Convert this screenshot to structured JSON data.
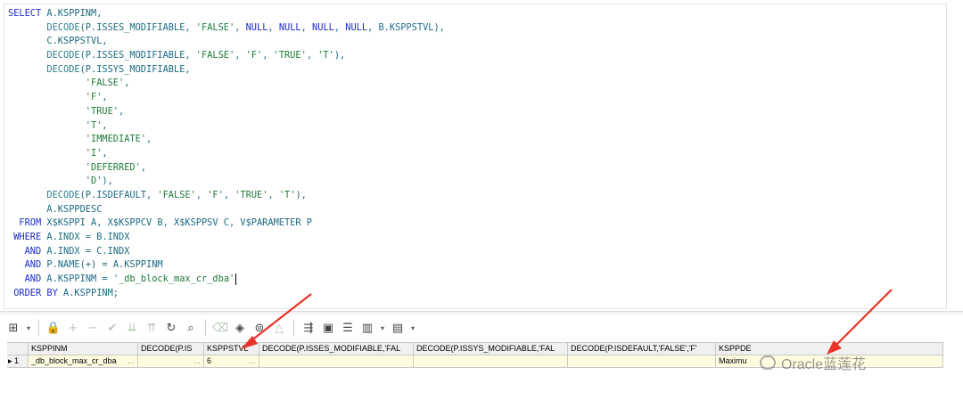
{
  "editor": {
    "lines": [
      [
        {
          "t": "SELECT ",
          "c": "kw"
        },
        {
          "t": "A.KSPPINM,",
          "c": ""
        }
      ],
      [
        {
          "t": "       ",
          "c": ""
        },
        {
          "t": "DECODE",
          "c": "fn"
        },
        {
          "t": "(P.ISSES_MODIFIABLE, ",
          "c": ""
        },
        {
          "t": "'FALSE'",
          "c": "str"
        },
        {
          "t": ", ",
          "c": ""
        },
        {
          "t": "NULL",
          "c": "nul"
        },
        {
          "t": ", ",
          "c": ""
        },
        {
          "t": "NULL",
          "c": "nul"
        },
        {
          "t": ", ",
          "c": ""
        },
        {
          "t": "NULL",
          "c": "nul"
        },
        {
          "t": ", ",
          "c": ""
        },
        {
          "t": "NULL",
          "c": "nul"
        },
        {
          "t": ", B.KSPPSTVL),",
          "c": ""
        }
      ],
      [
        {
          "t": "       C.KSPPSTVL,",
          "c": ""
        }
      ],
      [
        {
          "t": "       ",
          "c": ""
        },
        {
          "t": "DECODE",
          "c": "fn"
        },
        {
          "t": "(P.ISSES_MODIFIABLE, ",
          "c": ""
        },
        {
          "t": "'FALSE'",
          "c": "str"
        },
        {
          "t": ", ",
          "c": ""
        },
        {
          "t": "'F'",
          "c": "str"
        },
        {
          "t": ", ",
          "c": ""
        },
        {
          "t": "'TRUE'",
          "c": "str"
        },
        {
          "t": ", ",
          "c": ""
        },
        {
          "t": "'T'",
          "c": "str"
        },
        {
          "t": "),",
          "c": ""
        }
      ],
      [
        {
          "t": "       ",
          "c": ""
        },
        {
          "t": "DECODE",
          "c": "fn"
        },
        {
          "t": "(P.ISSYS_MODIFIABLE,",
          "c": ""
        }
      ],
      [
        {
          "t": "              ",
          "c": ""
        },
        {
          "t": "'FALSE'",
          "c": "str"
        },
        {
          "t": ",",
          "c": ""
        }
      ],
      [
        {
          "t": "              ",
          "c": ""
        },
        {
          "t": "'F'",
          "c": "str"
        },
        {
          "t": ",",
          "c": ""
        }
      ],
      [
        {
          "t": "              ",
          "c": ""
        },
        {
          "t": "'TRUE'",
          "c": "str"
        },
        {
          "t": ",",
          "c": ""
        }
      ],
      [
        {
          "t": "              ",
          "c": ""
        },
        {
          "t": "'T'",
          "c": "str"
        },
        {
          "t": ",",
          "c": ""
        }
      ],
      [
        {
          "t": "              ",
          "c": ""
        },
        {
          "t": "'IMMEDIATE'",
          "c": "str"
        },
        {
          "t": ",",
          "c": ""
        }
      ],
      [
        {
          "t": "              ",
          "c": ""
        },
        {
          "t": "'I'",
          "c": "str"
        },
        {
          "t": ",",
          "c": ""
        }
      ],
      [
        {
          "t": "              ",
          "c": ""
        },
        {
          "t": "'DEFERRED'",
          "c": "str"
        },
        {
          "t": ",",
          "c": ""
        }
      ],
      [
        {
          "t": "              ",
          "c": ""
        },
        {
          "t": "'D'",
          "c": "str"
        },
        {
          "t": "),",
          "c": ""
        }
      ],
      [
        {
          "t": "       ",
          "c": ""
        },
        {
          "t": "DECODE",
          "c": "fn"
        },
        {
          "t": "(P.ISDEFAULT, ",
          "c": ""
        },
        {
          "t": "'FALSE'",
          "c": "str"
        },
        {
          "t": ", ",
          "c": ""
        },
        {
          "t": "'F'",
          "c": "str"
        },
        {
          "t": ", ",
          "c": ""
        },
        {
          "t": "'TRUE'",
          "c": "str"
        },
        {
          "t": ", ",
          "c": ""
        },
        {
          "t": "'T'",
          "c": "str"
        },
        {
          "t": "),",
          "c": ""
        }
      ],
      [
        {
          "t": "       A.KSPPDESC",
          "c": ""
        }
      ],
      [
        {
          "t": "  ",
          "c": ""
        },
        {
          "t": "FROM ",
          "c": "kw"
        },
        {
          "t": "X$KSPPI A, X$KSPPCV B, X$KSPPSV C, V$PARAMETER P",
          "c": ""
        }
      ],
      [
        {
          "t": " ",
          "c": ""
        },
        {
          "t": "WHERE ",
          "c": "kw"
        },
        {
          "t": "A.INDX = B.INDX",
          "c": ""
        }
      ],
      [
        {
          "t": "   ",
          "c": ""
        },
        {
          "t": "AND ",
          "c": "kw"
        },
        {
          "t": "A.INDX = C.INDX",
          "c": ""
        }
      ],
      [
        {
          "t": "   ",
          "c": ""
        },
        {
          "t": "AND ",
          "c": "kw"
        },
        {
          "t": "P.NAME(+) = A.KSPPINM",
          "c": ""
        }
      ],
      [
        {
          "t": "   ",
          "c": ""
        },
        {
          "t": "AND ",
          "c": "kw"
        },
        {
          "t": "A.KSPPINM = ",
          "c": ""
        },
        {
          "t": "'_db_block_max_cr_dba'",
          "c": "str"
        },
        {
          "t": "",
          "c": "caret"
        }
      ],
      [
        {
          "t": " ",
          "c": ""
        },
        {
          "t": "ORDER BY ",
          "c": "kw"
        },
        {
          "t": "A.KSPPINM;",
          "c": ""
        }
      ]
    ]
  },
  "toolbar": {
    "buttons": [
      {
        "name": "grid-view-icon",
        "glyph": "⊞",
        "enabled": true
      },
      {
        "name": "dropdown-arrow-icon",
        "glyph": "▾",
        "enabled": true,
        "dd": true
      },
      {
        "name": "lock-icon",
        "glyph": "🔒",
        "enabled": true
      },
      {
        "name": "add-row-icon",
        "glyph": "+",
        "enabled": false
      },
      {
        "name": "delete-row-icon",
        "glyph": "−",
        "enabled": false
      },
      {
        "name": "post-changes-icon",
        "glyph": "✔",
        "enabled": false
      },
      {
        "name": "filter-down-icon",
        "glyph": "⇊",
        "enabled": false
      },
      {
        "name": "filter-clear-icon",
        "glyph": "⇈",
        "enabled": false
      },
      {
        "name": "refresh-icon",
        "glyph": "↻",
        "enabled": true
      },
      {
        "name": "find-icon",
        "glyph": "⌕",
        "enabled": true
      },
      {
        "name": "clear-icon",
        "glyph": "⌫",
        "enabled": false
      },
      {
        "name": "single-record-icon",
        "glyph": "◈",
        "enabled": true
      },
      {
        "name": "query-by-example-icon",
        "glyph": "⊜",
        "enabled": true
      },
      {
        "name": "triangle-icon",
        "glyph": "△",
        "enabled": false
      },
      {
        "name": "export-icon",
        "glyph": "⇶",
        "enabled": true
      },
      {
        "name": "save-icon",
        "glyph": "▣",
        "enabled": true
      },
      {
        "name": "stack-icon",
        "glyph": "☰",
        "enabled": true
      },
      {
        "name": "chart-icon",
        "glyph": "▥",
        "enabled": true
      },
      {
        "name": "dropdown-arrow-icon",
        "glyph": "▾",
        "enabled": true,
        "dd": true
      },
      {
        "name": "table-icon",
        "glyph": "▤",
        "enabled": true
      },
      {
        "name": "dropdown-arrow-icon",
        "glyph": "▾",
        "enabled": true,
        "dd": true
      }
    ]
  },
  "grid": {
    "columns": [
      "",
      "KSPPINM",
      "DECODE(P.IS",
      "KSPPSTVL",
      "DECODE(P.ISSES_MODIFIABLE,'FAL",
      "DECODE(P.ISSYS_MODIFIABLE,'FAL",
      "DECODE(P.ISDEFAULT,'FALSE','F'",
      "KSPPDE"
    ],
    "rows": [
      [
        "▸ 1",
        "_db_block_max_cr_dba",
        "",
        "6",
        "",
        "",
        "",
        "Maximu"
      ]
    ]
  },
  "watermark": {
    "text": "Oracle蓝莲花"
  }
}
